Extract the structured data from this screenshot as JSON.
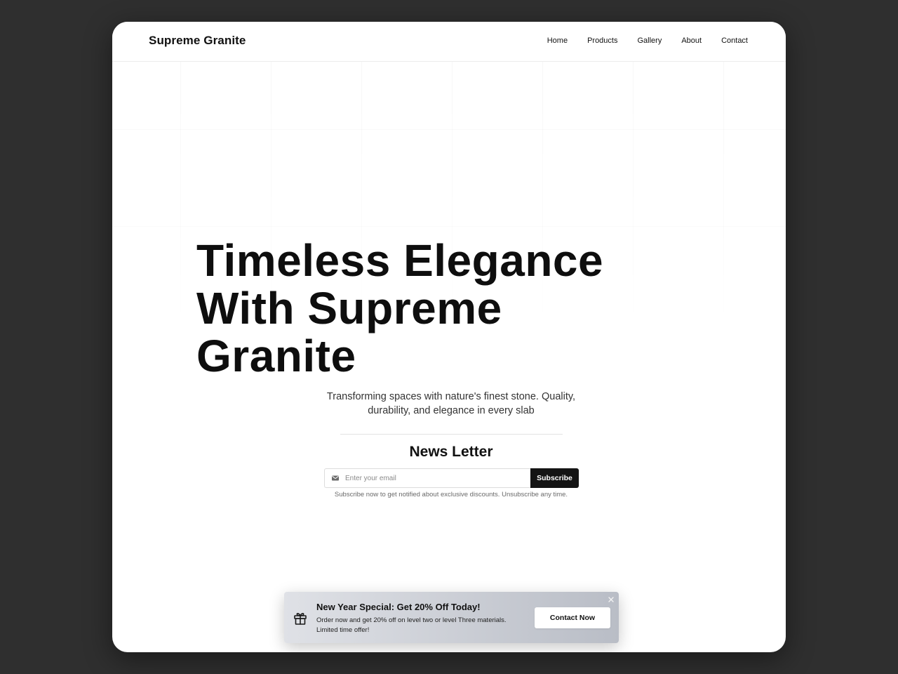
{
  "brand": "Supreme Granite",
  "nav": {
    "items": [
      {
        "label": "Home"
      },
      {
        "label": "Products"
      },
      {
        "label": "Gallery"
      },
      {
        "label": "About"
      },
      {
        "label": "Contact"
      }
    ]
  },
  "hero": {
    "title_lines": [
      "Timeless Elegance",
      "With Supreme",
      "Granite"
    ],
    "subtitle": "Transforming spaces with nature's finest stone. Quality, durability, and elegance in every slab"
  },
  "newsletter": {
    "title": "News Letter",
    "email_placeholder": "Enter your email",
    "email_value": "",
    "subscribe_label": "Subscribe",
    "note": "Subscribe now to get notified about exclusive discounts. Unsubscribe any time."
  },
  "promo": {
    "title": "New Year Special: Get 20% Off Today!",
    "text": "Order now and get 20% off on level two or level Three materials. Limited time offer!",
    "button_label": "Contact Now",
    "icon": "gift-icon",
    "close_icon": "close-icon"
  },
  "colors": {
    "background": "#2f2f2f",
    "surface": "#ffffff",
    "text": "#111111",
    "button_dark": "#141414"
  }
}
